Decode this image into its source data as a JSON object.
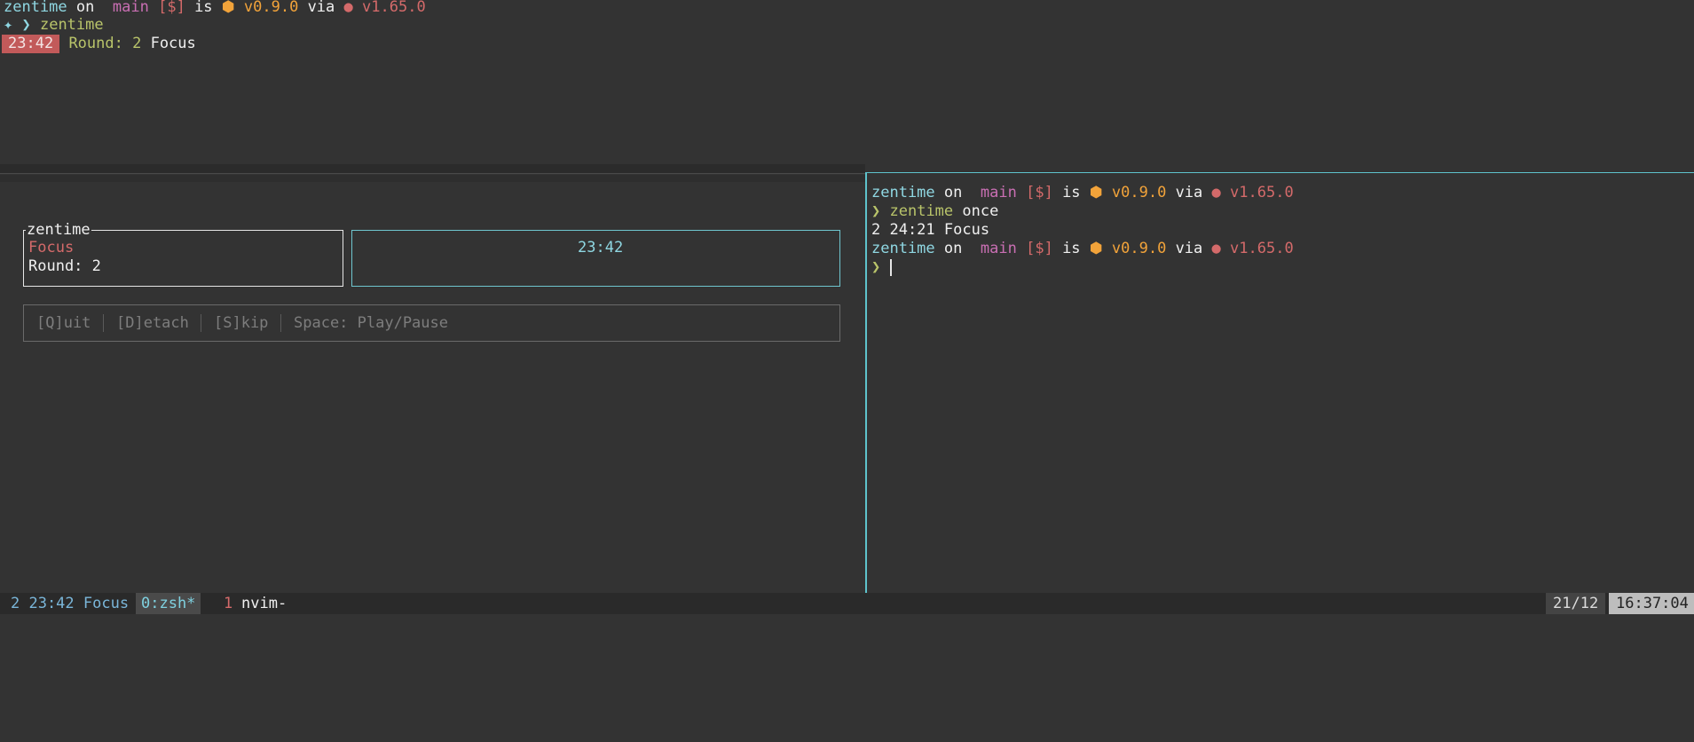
{
  "prompt": {
    "dir": "zentime",
    "on": "on",
    "branch_icon": "",
    "branch": "main",
    "git_status": "[$]",
    "is": "is",
    "pkg_icon": "⬢",
    "pkg_version": "v0.9.0",
    "via": "via",
    "rust_icon": "●",
    "rust_version": "v1.65.0",
    "arrow": "❯",
    "plus_arrow": "✦ ❯"
  },
  "top_pane": {
    "command": "zentime",
    "timer": "23:42",
    "round_label": "Round: 2",
    "phase": "Focus"
  },
  "tui": {
    "title": "zentime",
    "phase": "Focus",
    "round": "Round: 2",
    "timer": "23:42",
    "help": [
      "[Q]uit",
      "[D]etach",
      "[S]kip",
      "Space: Play/Pause"
    ]
  },
  "right_pane": {
    "command": "zentime",
    "arg": "once",
    "output": "2 24:21 Focus"
  },
  "statusbar": {
    "session": "2 23:42 Focus",
    "window0": "0:zsh*",
    "window1_index": "1",
    "window1_name": "nvim-",
    "date": "21/12",
    "time": "16:37:04"
  }
}
